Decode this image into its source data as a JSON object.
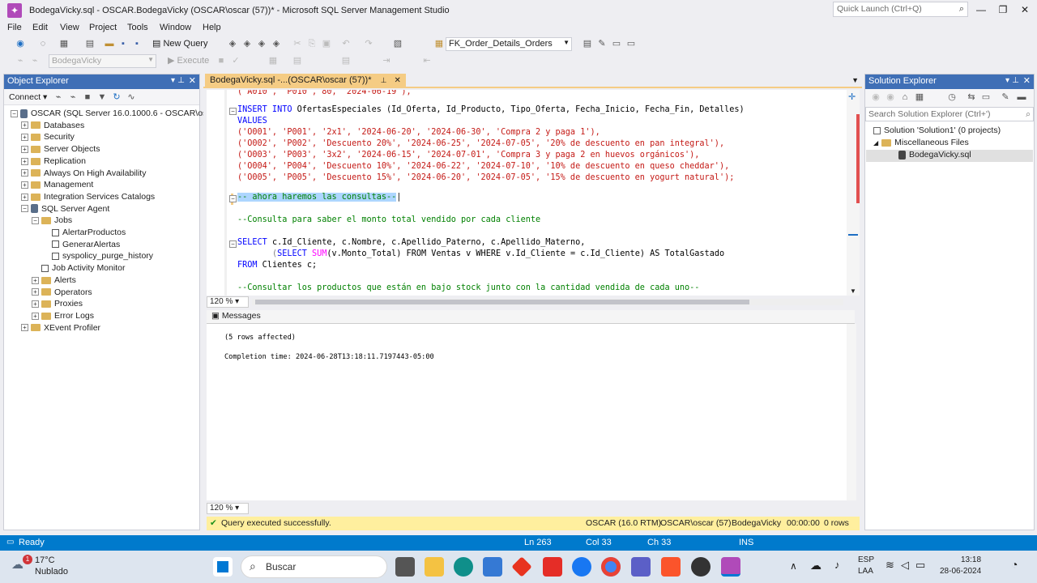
{
  "window": {
    "title": "BodegaVicky.sql - OSCAR.BodegaVicky (OSCAR\\oscar (57))* - Microsoft SQL Server Management Studio",
    "quick_launch": "Quick Launch (Ctrl+Q)"
  },
  "menu": [
    "File",
    "Edit",
    "View",
    "Project",
    "Tools",
    "Window",
    "Help"
  ],
  "toolbar": {
    "new_query": "New Query",
    "object_combo": "FK_Order_Details_Orders",
    "db_combo": "BodegaVicky",
    "execute": "Execute"
  },
  "object_explorer": {
    "title": "Object Explorer",
    "connect": "Connect",
    "tree": [
      {
        "label": "OSCAR (SQL Server 16.0.1000.6 - OSCAR\\oscar)",
        "icon": "server-icon",
        "expander": "−"
      },
      {
        "label": "Databases",
        "icon": "folder-icon",
        "expander": "+"
      },
      {
        "label": "Security",
        "icon": "folder-icon",
        "expander": "+"
      },
      {
        "label": "Server Objects",
        "icon": "folder-icon",
        "expander": "+"
      },
      {
        "label": "Replication",
        "icon": "folder-icon",
        "expander": "+"
      },
      {
        "label": "Always On High Availability",
        "icon": "folder-icon",
        "expander": "+"
      },
      {
        "label": "Management",
        "icon": "folder-icon",
        "expander": "+"
      },
      {
        "label": "Integration Services Catalogs",
        "icon": "folder-icon",
        "expander": "+"
      },
      {
        "label": "SQL Server Agent",
        "icon": "agent-icon",
        "expander": "−"
      },
      {
        "label": "Jobs",
        "icon": "folder-icon",
        "expander": "−"
      },
      {
        "label": "AlertarProductos",
        "icon": "job-icon",
        "expander": ""
      },
      {
        "label": "GenerarAlertas",
        "icon": "job-icon",
        "expander": ""
      },
      {
        "label": "syspolicy_purge_history",
        "icon": "job-icon",
        "expander": ""
      },
      {
        "label": "Job Activity Monitor",
        "icon": "monitor-icon",
        "expander": ""
      },
      {
        "label": "Alerts",
        "icon": "folder-icon",
        "expander": "+"
      },
      {
        "label": "Operators",
        "icon": "folder-icon",
        "expander": "+"
      },
      {
        "label": "Proxies",
        "icon": "folder-icon",
        "expander": "+"
      },
      {
        "label": "Error Logs",
        "icon": "folder-icon",
        "expander": "+"
      },
      {
        "label": "XEvent Profiler",
        "icon": "folder-icon",
        "expander": "+"
      }
    ]
  },
  "editor": {
    "tab": "BodegaVicky.sql -...(OSCAR\\oscar (57))*",
    "top_partial": "('A010', 'P010', 80, '2024-06-19'),",
    "insert_line": "INSERT INTO OfertasEspeciales (Id_Oferta, Id_Producto, Tipo_Oferta, Fecha_Inicio, Fecha_Fin, Detalles)",
    "values_kw": "VALUES",
    "rows": [
      "('O001', 'P001', '2x1', '2024-06-20', '2024-06-30', 'Compra 2 y paga 1'),",
      "('O002', 'P002', 'Descuento 20%', '2024-06-25', '2024-07-05', '20% de descuento en pan integral'),",
      "('O003', 'P003', '3x2', '2024-06-15', '2024-07-01', 'Compra 3 y paga 2 en huevos orgánicos'),",
      "('O004', 'P004', 'Descuento 10%', '2024-06-22', '2024-07-10', '10% de descuento en queso cheddar'),",
      "('O005', 'P005', 'Descuento 15%', '2024-06-20', '2024-07-05', '15% de descuento en yogurt natural');"
    ],
    "comment1": "-- ahora haremos las consultas--",
    "comment2": "--Consulta para saber el monto total vendido por cada cliente",
    "select1": "SELECT c.Id_Cliente, c.Nombre, c.Apellido_Paterno, c.Apellido_Materno,",
    "select2": "(SELECT SUM(v.Monto_Total) FROM Ventas v WHERE v.Id_Cliente = c.Id_Cliente) AS TotalGastado",
    "from_line": "FROM Clientes c;",
    "comment3": "--Consultar los productos que están en bajo stock junto con la cantidad vendida de cada uno--",
    "zoom": "120 %"
  },
  "results": {
    "tab": "Messages",
    "rows_affected": "(5 rows affected)",
    "completion": "Completion time: 2024-06-28T13:18:11.7197443-05:00",
    "zoom": "120 %",
    "status": "Query executed successfully.",
    "server": "OSCAR (16.0 RTM)",
    "user": "OSCAR\\oscar (57)",
    "db": "BodegaVicky",
    "time": "00:00:00",
    "row_count": "0 rows"
  },
  "solution_explorer": {
    "title": "Solution Explorer",
    "search_placeholder": "Search Solution Explorer (Ctrl+')",
    "solution": "Solution 'Solution1' (0 projects)",
    "folder": "Miscellaneous Files",
    "file": "BodegaVicky.sql"
  },
  "statusbar": {
    "ready": "Ready",
    "ln": "Ln 263",
    "col": "Col 33",
    "ch": "Ch 33",
    "ins": "INS"
  },
  "taskbar": {
    "weather_temp": "17°C",
    "weather_desc": "Nublado",
    "search": "Buscar",
    "lang1": "ESP",
    "lang2": "LAA",
    "time": "13:18",
    "date": "28-06-2024",
    "notif_badge": "1"
  },
  "colors": {
    "accent": "#007acc",
    "tab_active": "#f5cc84",
    "panel_header": "#3f6fb6",
    "success_strip": "#ffef9e"
  }
}
